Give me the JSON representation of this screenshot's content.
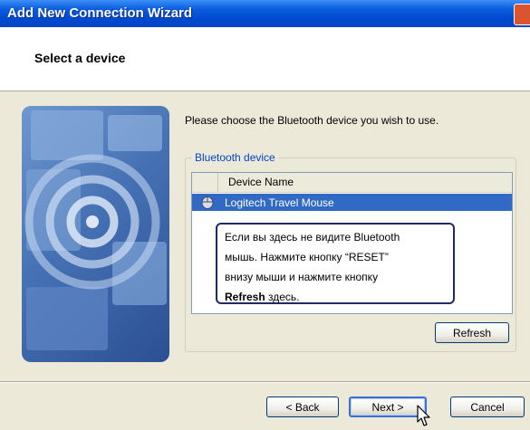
{
  "window": {
    "title": "Add New Connection Wizard"
  },
  "header": {
    "title": "Select a device"
  },
  "main": {
    "instruction": "Please choose the Bluetooth device you wish to use.",
    "group_label": "Bluetooth device",
    "list": {
      "column_header": "Device Name",
      "rows": [
        {
          "name": "Logitech Travel Mouse",
          "icon": "mouse-icon",
          "selected": true
        }
      ]
    },
    "callout": {
      "line1": "Если вы здесь не видите Bluetooth",
      "line2": "мышь. Нажмите кнопку “RESET”",
      "line3": "внизу мыши и нажмите кнопку",
      "bold": "Refresh",
      "line4_rest": " здесь."
    },
    "refresh_label": "Refresh"
  },
  "footer": {
    "back_label": "< Back",
    "next_label": "Next >",
    "cancel_label": "Cancel"
  },
  "colors": {
    "title_bar": "#0a5bdc",
    "selection": "#316ac5",
    "group_label": "#0046d5",
    "callout_border": "#1f2a66"
  }
}
